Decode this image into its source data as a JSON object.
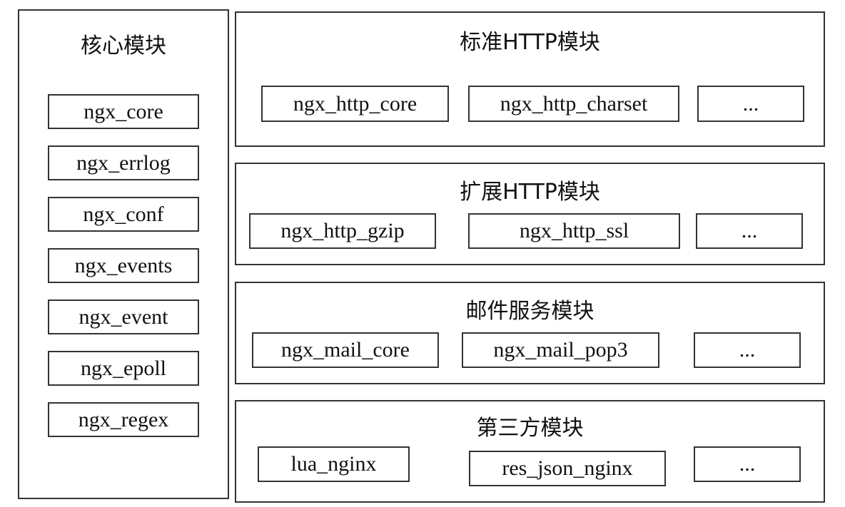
{
  "core": {
    "title": "核心模块",
    "items": [
      "ngx_core",
      "ngx_errlog",
      "ngx_conf",
      "ngx_events",
      "ngx_event",
      "ngx_epoll",
      "ngx_regex"
    ]
  },
  "groups": [
    {
      "title": "标准HTTP模块",
      "items": [
        "ngx_http_core",
        "ngx_http_charset",
        "..."
      ]
    },
    {
      "title": "扩展HTTP模块",
      "items": [
        "ngx_http_gzip",
        "ngx_http_ssl",
        "..."
      ]
    },
    {
      "title": "邮件服务模块",
      "items": [
        "ngx_mail_core",
        "ngx_mail_pop3",
        "..."
      ]
    },
    {
      "title": "第三方模块",
      "items": [
        "lua_nginx",
        "res_json_nginx",
        "..."
      ]
    }
  ]
}
